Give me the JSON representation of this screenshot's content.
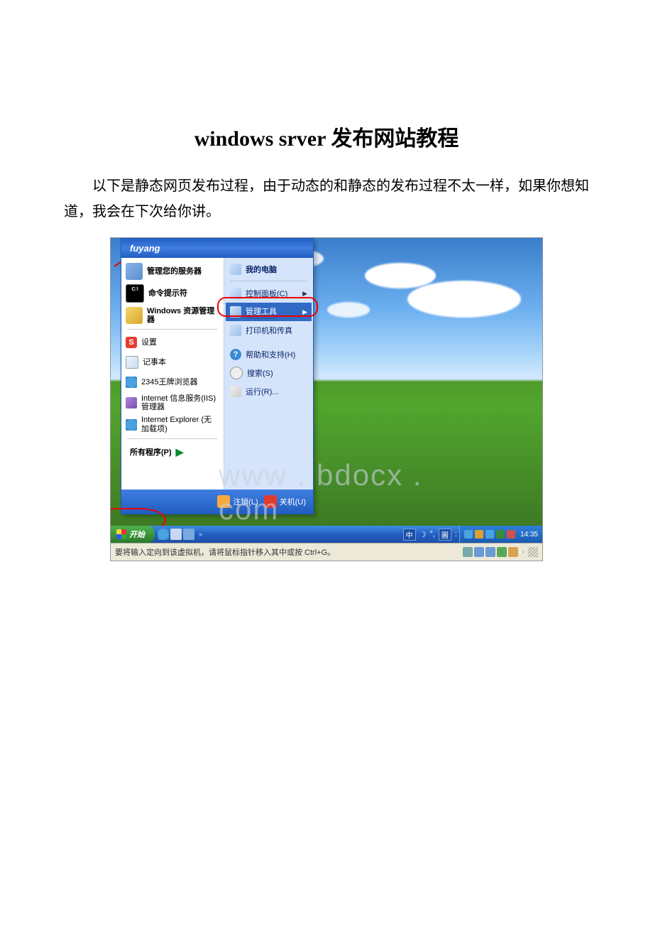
{
  "doc": {
    "title_en": "windows srver ",
    "title_zh": "发布网站教程",
    "body": "以下是静态网页发布过程，由于动态的和静态的发布过程不太一样，如果你想知道，我会在下次给你讲。"
  },
  "startmenu": {
    "user": "fuyang",
    "left": [
      {
        "label": "管理您的服务器",
        "icon": "i-srv"
      },
      {
        "label": "命令提示符",
        "icon": "i-cmd",
        "icontext": "C:\\"
      },
      {
        "label": "Windows 资源管理器",
        "icon": "i-exp"
      },
      {
        "label": "设置",
        "icon": "i-s",
        "icontext": "S"
      },
      {
        "label": "记事本",
        "icon": "i-note"
      },
      {
        "label": "2345王牌浏览器",
        "icon": "i-ie"
      },
      {
        "label": "Internet 信息服务(IIS)管理器",
        "icon": "i-iis"
      },
      {
        "label": "Internet Explorer (无加载项)",
        "icon": "i-ie"
      }
    ],
    "all_programs": "所有程序(P)",
    "right_header": "我的电脑",
    "right": [
      {
        "label": "控制面板(C)",
        "icon": "i-cp",
        "arrow": true
      },
      {
        "label": "管理工具",
        "icon": "i-adm",
        "arrow": true,
        "hl": true,
        "underline": true
      },
      {
        "label": "打印机和传真",
        "icon": "i-prn"
      },
      {
        "label": "帮助和支持(H)",
        "icon": "i-help",
        "icontext": "?",
        "gap": true
      },
      {
        "label": "搜索(S)",
        "icon": "i-sch"
      },
      {
        "label": "运行(R)...",
        "icon": "i-run"
      }
    ],
    "logoff": "注销(L)",
    "shutdown": "关机(U)"
  },
  "taskbar": {
    "start": "开始",
    "lang_items": [
      "中",
      "°,",
      "圖",
      ":"
    ],
    "clock": "14:35"
  },
  "vm_status": "要将输入定向到该虚拟机，请将鼠标指针移入其中或按 Ctrl+G。",
  "watermark": "www . bdocx . com",
  "moon": "☽"
}
